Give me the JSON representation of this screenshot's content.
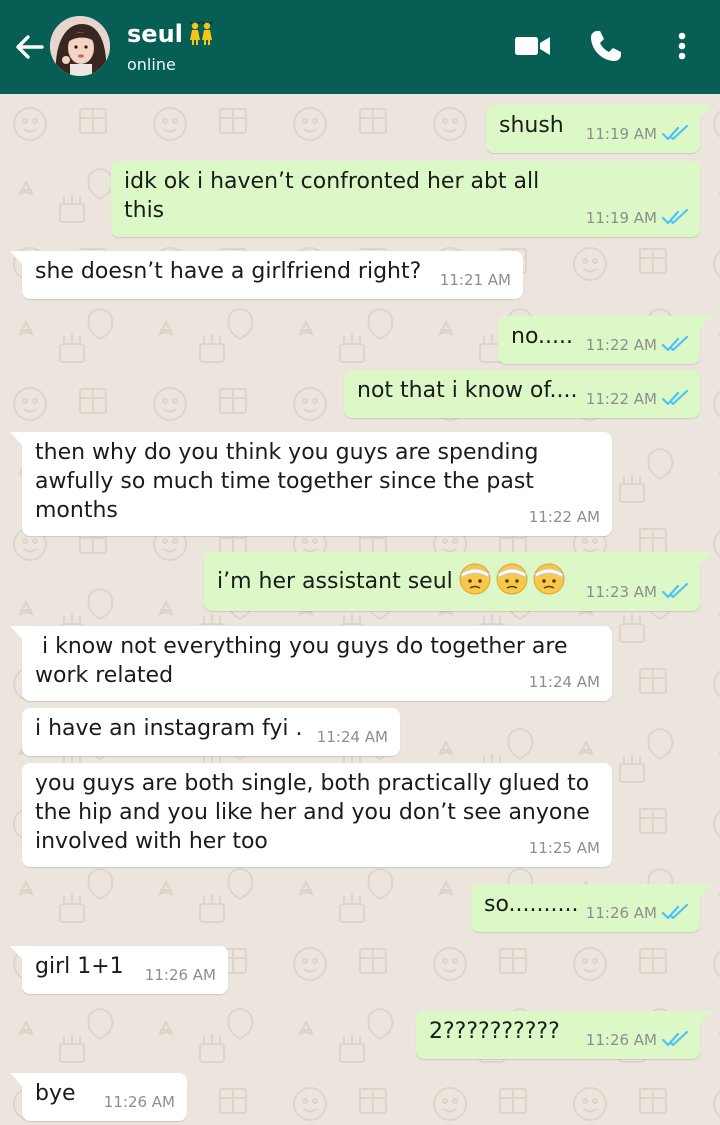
{
  "header": {
    "contact_name": "seul",
    "status": "online",
    "colors": {
      "bar": "#075e54",
      "icons": "#ffffff"
    },
    "icons": [
      "back-arrow-icon",
      "avatar",
      "dancers-emoji-icon",
      "video-call-icon",
      "phone-icon",
      "more-vert-icon"
    ]
  },
  "chat": {
    "colors": {
      "outgoing": "#dcf8c6",
      "incoming": "#ffffff",
      "read_ticks": "#4fc3f7",
      "wallpaper": "#ece5dd"
    },
    "messages": [
      {
        "dir": "out",
        "text": "shush",
        "time": "11:19 AM"
      },
      {
        "dir": "out",
        "line1": "idk ok i haven’t confronted her abt all",
        "line2": "this",
        "time": "11:19 AM"
      },
      {
        "dir": "in",
        "text": "she doesn’t have a girlfriend right?",
        "time": "11:21 AM"
      },
      {
        "dir": "out",
        "text": "no.....",
        "time": "11:22 AM"
      },
      {
        "dir": "out",
        "text": "not that i know of....",
        "time": "11:22 AM"
      },
      {
        "dir": "in",
        "line1": "then why do you think you guys are spending",
        "line2": "awfully so much time together since the past",
        "line3": "months",
        "time": "11:22 AM"
      },
      {
        "dir": "out",
        "text": "i’m her assistant seul",
        "emoji": "face-with-head-bandage-icon ×3",
        "time": "11:23 AM"
      },
      {
        "dir": "in",
        "line1": " i know not everything you guys do together are",
        "line2": "work related",
        "time": "11:24 AM"
      },
      {
        "dir": "in",
        "text": "i have an instagram fyi .",
        "time": "11:24 AM"
      },
      {
        "dir": "in",
        "line1": "you guys are both single, both practically glued to",
        "line2": "the hip and you like her and you don’t see anyone",
        "line3": "involved with her too",
        "time": "11:25 AM"
      },
      {
        "dir": "out",
        "text": "so..........",
        "time": "11:26 AM"
      },
      {
        "dir": "in",
        "text": "girl 1+1",
        "time": "11:26 AM"
      },
      {
        "dir": "out",
        "text": "2??????????",
        "time": "11:26 AM"
      },
      {
        "dir": "in",
        "text": "bye",
        "time": "11:26 AM"
      }
    ]
  }
}
